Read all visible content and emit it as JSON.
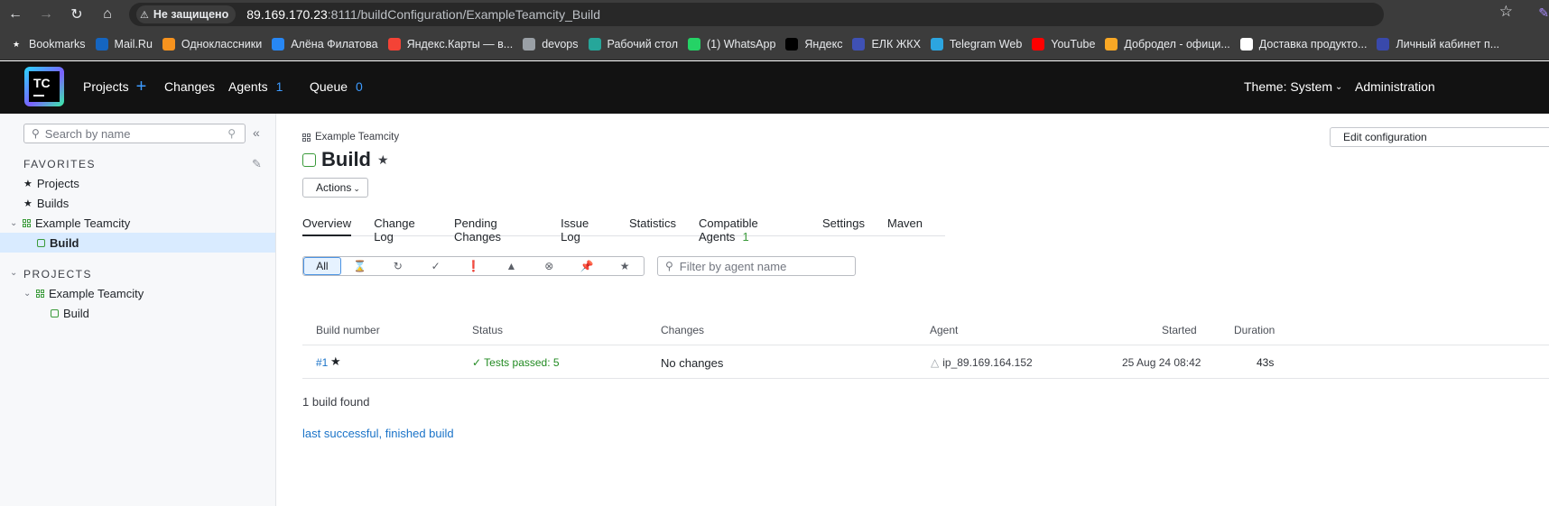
{
  "browser": {
    "security_label": "Не защищено",
    "url_host": "89.169.170.23",
    "url_path": ":8111/buildConfiguration/ExampleTeamcity_Build",
    "bookmarks": [
      {
        "label": "Bookmarks",
        "color": "#e8eaed"
      },
      {
        "label": "Mail.Ru",
        "color": "#1565c0"
      },
      {
        "label": "Одноклассники",
        "color": "#f7931e"
      },
      {
        "label": "Алёна Филатова",
        "color": "#2787f5"
      },
      {
        "label": "Яндекс.Карты — в...",
        "color": "#f44336"
      },
      {
        "label": "devops",
        "color": "#9aa0a6"
      },
      {
        "label": "Рабочий стол",
        "color": "#26a69a"
      },
      {
        "label": "(1) WhatsApp",
        "color": "#25d366"
      },
      {
        "label": "Яндекс",
        "color": "#000000"
      },
      {
        "label": "ЕЛК ЖКХ",
        "color": "#3f51b5"
      },
      {
        "label": "Telegram Web",
        "color": "#2ca5e0"
      },
      {
        "label": "YouTube",
        "color": "#ff0000"
      },
      {
        "label": "Добродел - офици...",
        "color": "#f9a825"
      },
      {
        "label": "Доставка продукто...",
        "color": "#ffffff"
      },
      {
        "label": "Личный кабинет п...",
        "color": "#3949ab"
      }
    ]
  },
  "header": {
    "projects": "Projects",
    "changes": "Changes",
    "agents": "Agents",
    "agents_count": "1",
    "queue": "Queue",
    "queue_count": "0",
    "theme": "Theme: System",
    "admin": "Administration"
  },
  "sidebar": {
    "search_placeholder": "Search by name",
    "favorites_title": "FAVORITES",
    "favorites": [
      {
        "label": "Projects"
      },
      {
        "label": "Builds"
      }
    ],
    "fav_project": "Example Teamcity",
    "fav_build": "Build",
    "projects_title": "PROJECTS",
    "proj_project": "Example Teamcity",
    "proj_build": "Build"
  },
  "main": {
    "breadcrumb": "Example Teamcity",
    "title": "Build",
    "edit_button": "Edit configuration",
    "actions_button": "Actions",
    "tabs": [
      {
        "label": "Overview"
      },
      {
        "label": "Change Log"
      },
      {
        "label": "Pending Changes"
      },
      {
        "label": "Issue Log"
      },
      {
        "label": "Statistics"
      },
      {
        "label": "Compatible Agents",
        "count": "1"
      },
      {
        "label": "Settings"
      },
      {
        "label": "Maven"
      }
    ],
    "filter_all": "All",
    "agent_filter_placeholder": "Filter by agent name",
    "columns": {
      "build_number": "Build number",
      "status": "Status",
      "changes": "Changes",
      "agent": "Agent",
      "started": "Started",
      "duration": "Duration"
    },
    "row": {
      "number": "#1",
      "status": "Tests passed: 5",
      "changes": "No changes",
      "agent": "ip_89.169.164.152",
      "started": "25 Aug 24 08:42",
      "duration": "43s"
    },
    "found": "1 build found",
    "last_link": "last successful, finished build"
  }
}
